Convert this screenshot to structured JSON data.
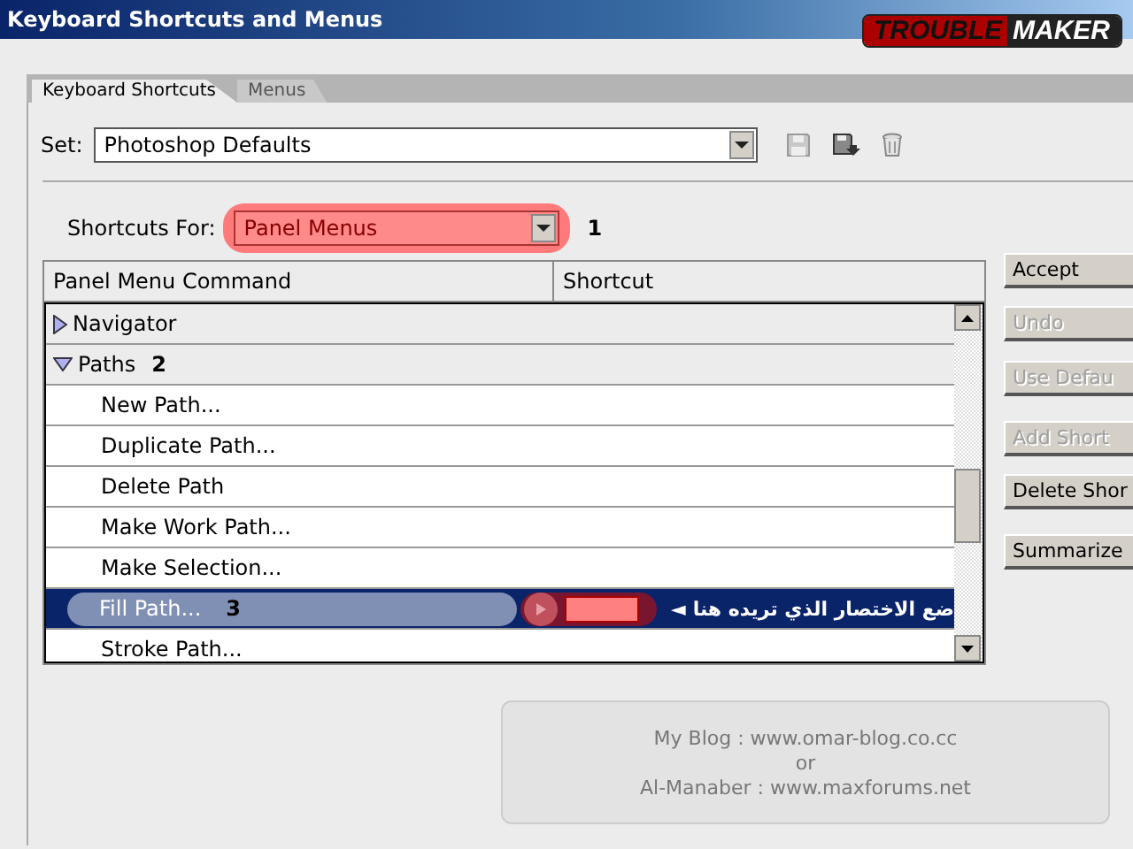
{
  "window": {
    "title": "Keyboard Shortcuts and Menus"
  },
  "logo": {
    "left": "TROUBLE",
    "right": "MAKER"
  },
  "tabs": [
    {
      "label": "Keyboard Shortcuts",
      "selected": true
    },
    {
      "label": "Menus",
      "selected": false
    }
  ],
  "set": {
    "label": "Set:",
    "value": "Photoshop Defaults"
  },
  "shortcuts_for": {
    "label": "Shortcuts For:",
    "value": "Panel Menus",
    "highlighted": true,
    "callout": "1"
  },
  "table": {
    "columns": [
      "Panel Menu Command",
      "Shortcut"
    ],
    "rows": [
      {
        "kind": "group",
        "label": "Navigator",
        "expanded": false
      },
      {
        "kind": "group",
        "label": "Paths",
        "expanded": true,
        "callout": "2"
      },
      {
        "kind": "item",
        "label": "New Path...",
        "selected": false
      },
      {
        "kind": "item",
        "label": "Duplicate Path...",
        "selected": false
      },
      {
        "kind": "item",
        "label": "Delete Path",
        "selected": false
      },
      {
        "kind": "item",
        "label": "Make Work Path...",
        "selected": false
      },
      {
        "kind": "item",
        "label": "Make Selection...",
        "selected": false
      },
      {
        "kind": "item",
        "label": "Fill Path...",
        "selected": true,
        "callout": "3",
        "hint_arrow": "◄",
        "hint": "ضع الاختصار الذي تريده هنا"
      },
      {
        "kind": "item",
        "label": "Stroke Path...",
        "selected": false
      }
    ]
  },
  "buttons": [
    {
      "label": "Accept",
      "disabled": false
    },
    {
      "label": "Undo",
      "disabled": true
    },
    {
      "label": "Use Defau",
      "disabled": true
    },
    {
      "label": "Add Short",
      "disabled": true
    },
    {
      "label": "Delete Shor",
      "disabled": false
    },
    {
      "label": "Summarize",
      "disabled": false
    }
  ],
  "credits": [
    "My Blog : www.omar-blog.co.cc",
    "or",
    "Al-Manaber : www.maxforums.net"
  ]
}
